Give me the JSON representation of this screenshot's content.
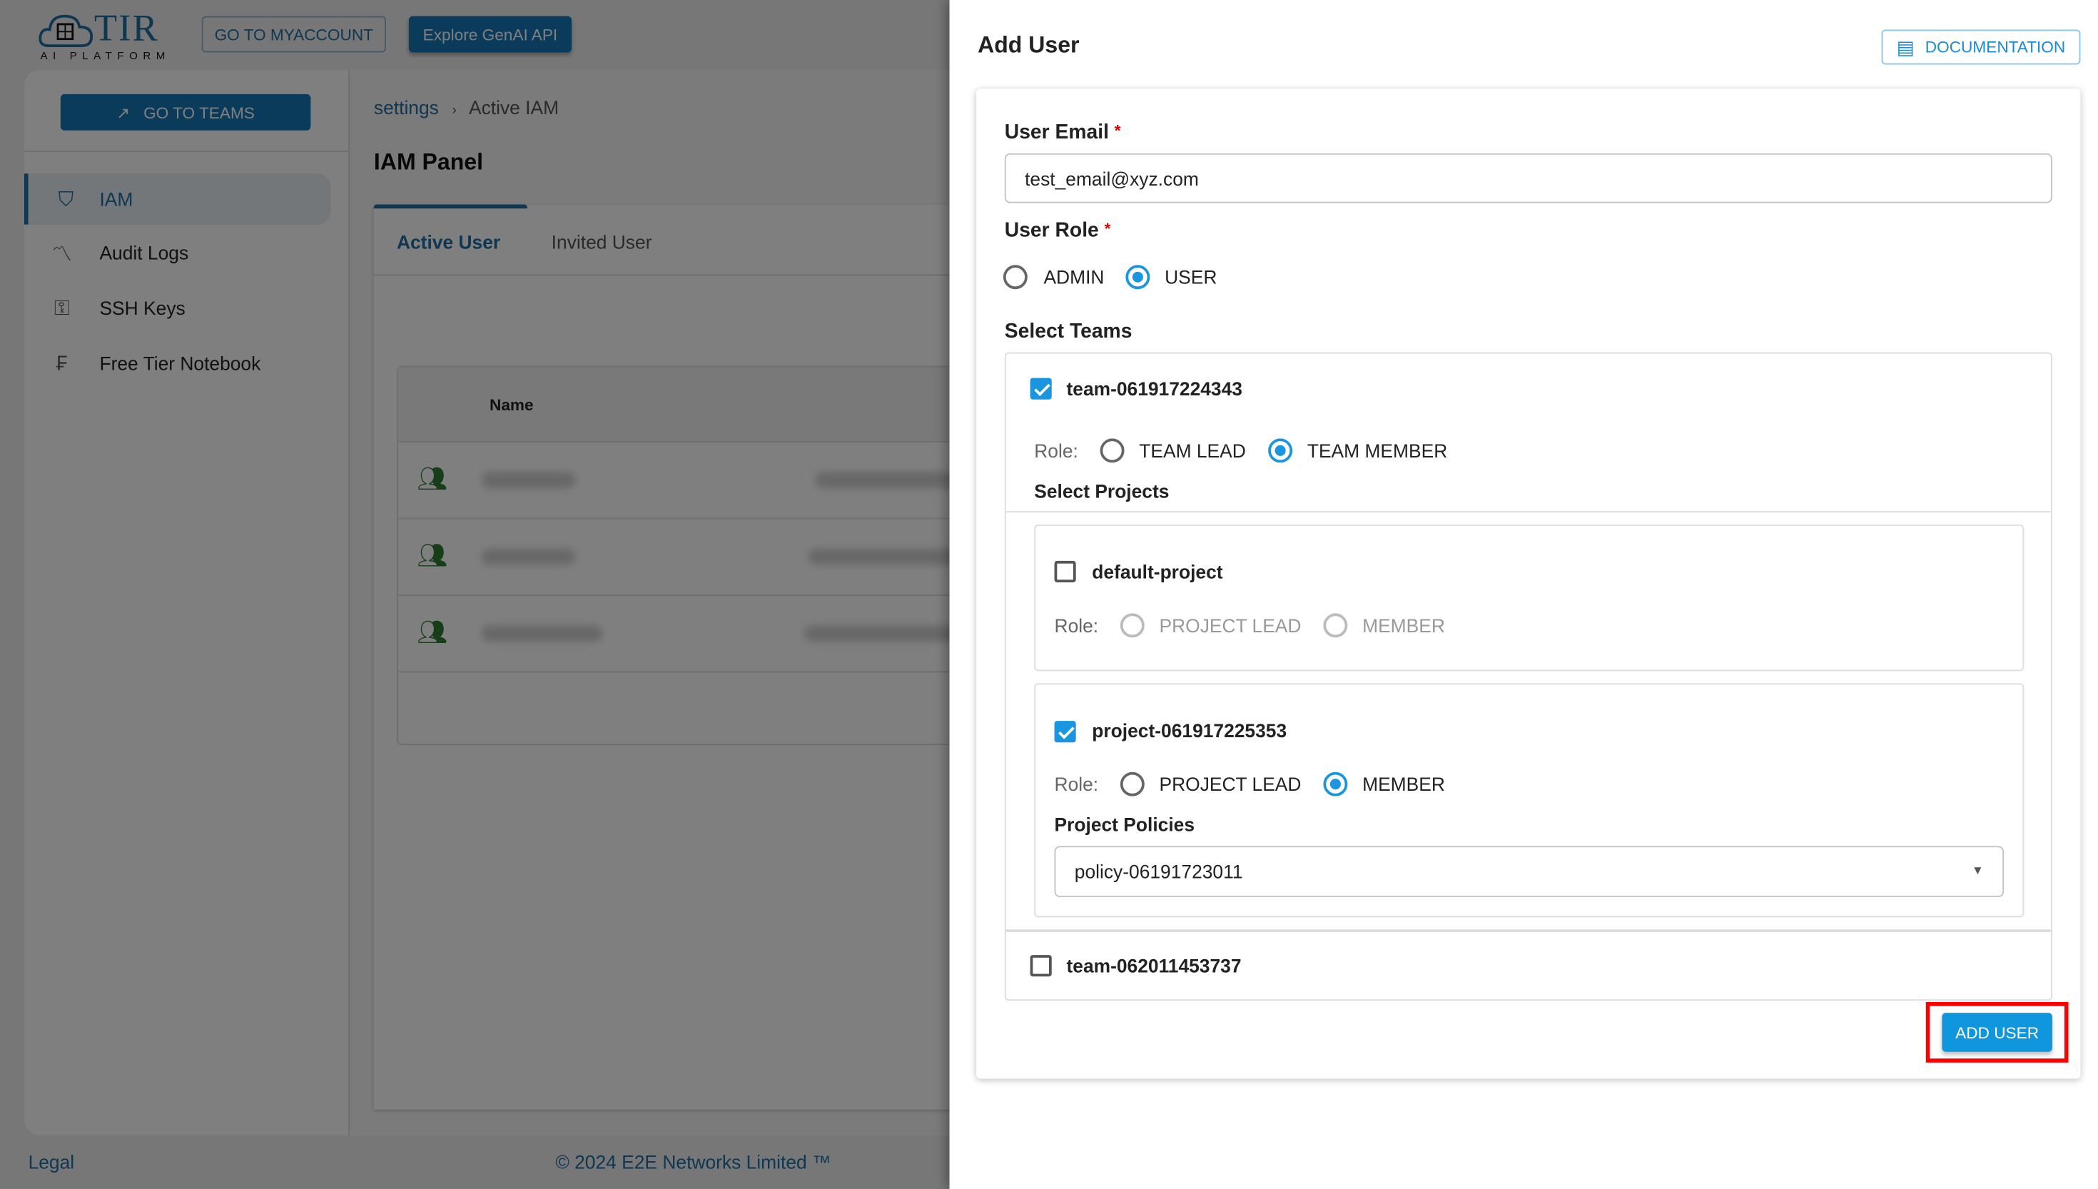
{
  "header": {
    "logo_text": "TIR",
    "logo_sub": "AI PLATFORM",
    "myaccount_label": "GO TO MYACCOUNT",
    "genai_label": "Explore GenAI API"
  },
  "sidebar": {
    "go_to_teams": "GO TO TEAMS",
    "items": [
      {
        "label": "IAM",
        "icon": "shield-user-icon",
        "selected": true
      },
      {
        "label": "Audit Logs",
        "icon": "audit-chart-icon"
      },
      {
        "label": "SSH Keys",
        "icon": "key-icon"
      },
      {
        "label": "Free Tier Notebook",
        "icon": "free-tier-icon"
      }
    ]
  },
  "breadcrumb": {
    "root": "settings",
    "separator": "›",
    "current": "Active IAM"
  },
  "main": {
    "title": "IAM Panel",
    "tabs": [
      {
        "label": "Active User",
        "active": true
      },
      {
        "label": "Invited User"
      }
    ],
    "table": {
      "columns": [
        "Name"
      ],
      "row_icon": "users-icon"
    }
  },
  "footer": {
    "legal": "Legal",
    "copyright": "© 2024 E2E Networks Limited ™"
  },
  "drawer": {
    "title": "Add User",
    "documentation_label": "DOCUMENTATION",
    "email_label": "User Email",
    "required_mark": "*",
    "email_value": "test_email@xyz.com",
    "role_label": "User Role",
    "roles": [
      {
        "label": "ADMIN",
        "selected": false
      },
      {
        "label": "USER",
        "selected": true
      }
    ],
    "teams_label": "Select Teams",
    "teams": [
      {
        "name": "team-061917224343",
        "checked": true,
        "role_label": "Role:",
        "roles": [
          {
            "label": "TEAM LEAD",
            "selected": false
          },
          {
            "label": "TEAM MEMBER",
            "selected": true
          }
        ],
        "projects_label": "Select Projects",
        "projects": [
          {
            "name": "default-project",
            "checked": false,
            "role_label": "Role:",
            "roles": [
              {
                "label": "PROJECT LEAD",
                "selected": false
              },
              {
                "label": "MEMBER",
                "selected": false
              }
            ],
            "disabled": true
          },
          {
            "name": "project-061917225353",
            "checked": true,
            "role_label": "Role:",
            "roles": [
              {
                "label": "PROJECT LEAD",
                "selected": false
              },
              {
                "label": "MEMBER",
                "selected": true
              }
            ],
            "policies_label": "Project Policies",
            "policy_value": "policy-06191723011"
          }
        ]
      },
      {
        "name": "team-062011453737",
        "checked": false
      }
    ],
    "add_user_label": "ADD USER"
  },
  "colors": {
    "primary": "#0f96dc",
    "brand": "#1577b5",
    "highlight": "#ff0000",
    "required": "#e00000"
  }
}
